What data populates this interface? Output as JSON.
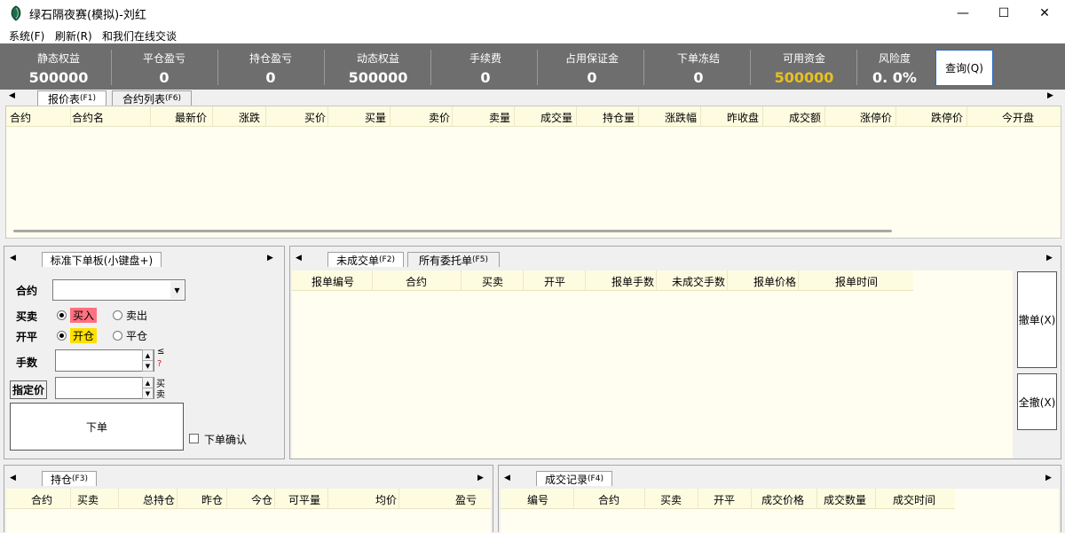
{
  "window": {
    "title": "绿石隔夜赛(模拟)-刘红",
    "min": "—",
    "max": "☐",
    "close": "✕"
  },
  "menu": [
    "系统(F)",
    "刷新(R)",
    "和我们在线交谈"
  ],
  "stats": [
    {
      "label": "静态权益",
      "value": "500000"
    },
    {
      "label": "平仓盈亏",
      "value": "0"
    },
    {
      "label": "持仓盈亏",
      "value": "0"
    },
    {
      "label": "动态权益",
      "value": "500000"
    },
    {
      "label": "手续费",
      "value": "0"
    },
    {
      "label": "占用保证金",
      "value": "0"
    },
    {
      "label": "下单冻结",
      "value": "0"
    },
    {
      "label": "可用资金",
      "value": "500000"
    },
    {
      "label": "风险度",
      "value": "0. 0%"
    }
  ],
  "colors": {
    "available_funds": "#e8c020",
    "buy_bg": "#ff7080",
    "open_bg": "#ffe000"
  },
  "query_button": "查询(Q)",
  "quote": {
    "tabs": [
      {
        "label": "报价表",
        "key": "(F1)"
      },
      {
        "label": "合约列表",
        "key": "(F6)"
      }
    ],
    "columns": [
      "合约",
      "合约名",
      "最新价",
      "涨跌",
      "买价",
      "买量",
      "卖价",
      "卖量",
      "成交量",
      "持仓量",
      "涨跌幅",
      "昨收盘",
      "成交额",
      "涨停价",
      "跌停价",
      "今开盘"
    ]
  },
  "order_panel": {
    "tab": {
      "label": "标准下单板",
      "key": "(小键盘+)"
    },
    "contract_label": "合约",
    "side_label": "买卖",
    "buy": "买入",
    "sell": "卖出",
    "openclose_label": "开平",
    "open": "开仓",
    "close": "平仓",
    "qty_label": "手数",
    "qty_side": "≤",
    "qty_side2": "?",
    "price_label": "指定价",
    "price_side": "买",
    "price_side2": "卖",
    "submit": "下单",
    "confirm": "下单确认"
  },
  "orders": {
    "tabs": [
      {
        "label": "未成交单",
        "key": "(F2)"
      },
      {
        "label": "所有委托单",
        "key": "(F5)"
      }
    ],
    "columns": [
      "报单编号",
      "合约",
      "买卖",
      "开平",
      "报单手数",
      "未成交手数",
      "报单价格",
      "报单时间"
    ],
    "cancel": "撤单(X)",
    "cancel_all": "全撤(X)"
  },
  "positions": {
    "tab": {
      "label": "持仓",
      "key": "(F3)"
    },
    "columns": [
      "合约",
      "买卖",
      "总持仓",
      "昨仓",
      "今仓",
      "可平量",
      "均价",
      "盈亏"
    ]
  },
  "trades": {
    "tab": {
      "label": "成交记录",
      "key": "(F4)"
    },
    "columns": [
      "编号",
      "合约",
      "买卖",
      "开平",
      "成交价格",
      "成交数量",
      "成交时间"
    ]
  }
}
